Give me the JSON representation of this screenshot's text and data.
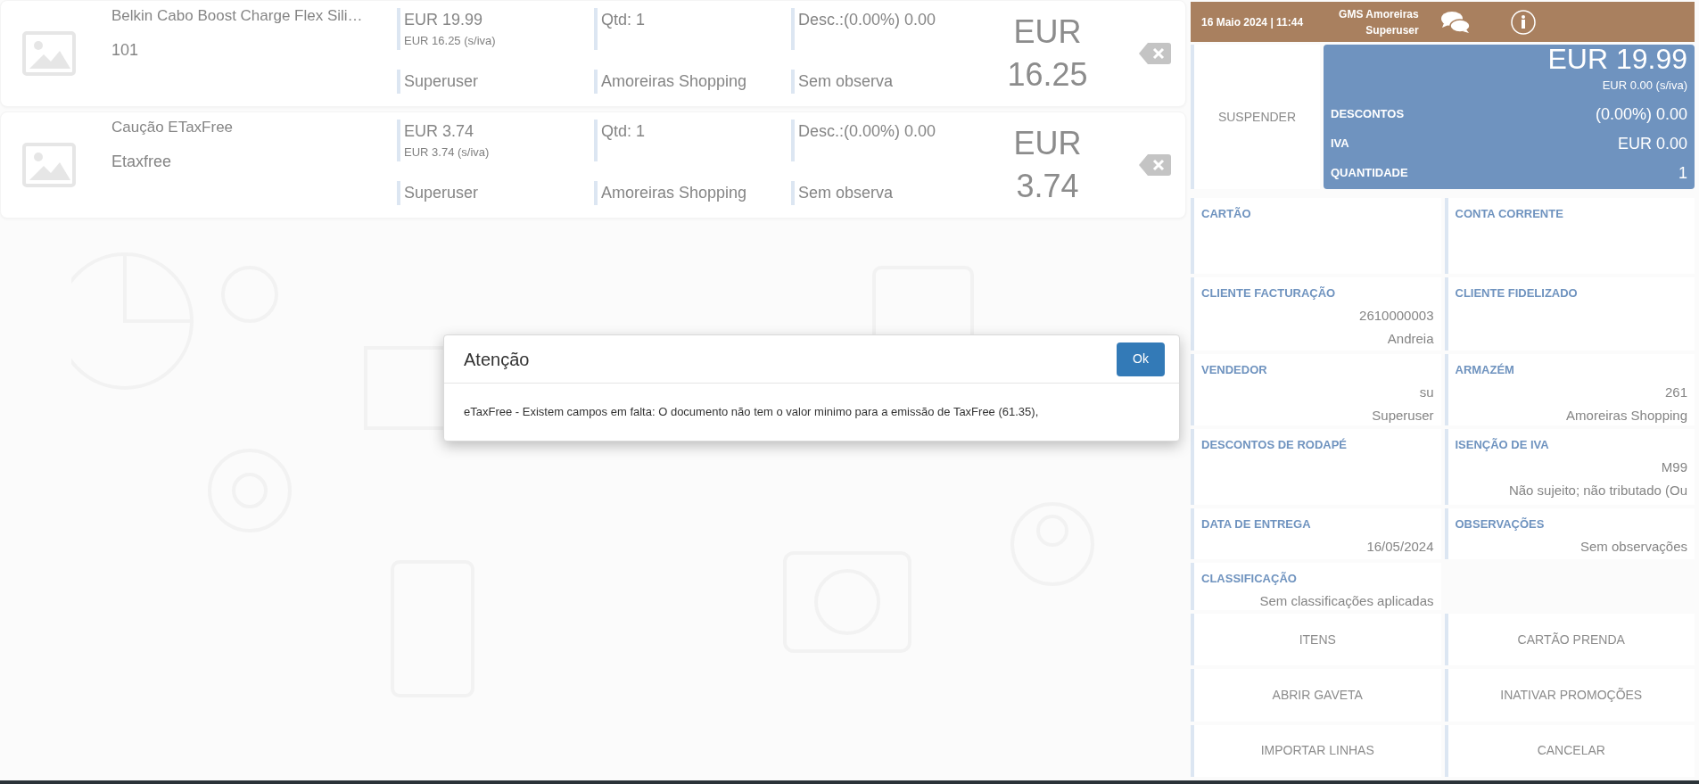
{
  "items": [
    {
      "name": "Belkin Cabo Boost Charge Flex Sili…",
      "code": "101",
      "price": "EUR 19.99",
      "price_net": "EUR 16.25 (s/iva)",
      "qty": "Qtd: 1",
      "discount": "Desc.:(0.00%) 0.00",
      "user": "Superuser",
      "store": "Amoreiras Shopping",
      "notes": "Sem observa",
      "total": "EUR 16.25"
    },
    {
      "name": "Caução ETaxFree",
      "code": "Etaxfree",
      "price": "EUR 3.74",
      "price_net": "EUR 3.74 (s/iva)",
      "qty": "Qtd: 1",
      "discount": "Desc.:(0.00%) 0.00",
      "user": "Superuser",
      "store": "Amoreiras Shopping",
      "notes": "Sem observa",
      "total": "EUR 3.74"
    }
  ],
  "header": {
    "datetime": "16 Maio 2024 | 11:44",
    "store": "GMS Amoreiras",
    "user": "Superuser"
  },
  "suspend_button": "SUSPENDER",
  "summary": {
    "total": "EUR 19.99",
    "total_net": "EUR 0.00 (s/iva)",
    "rows": [
      {
        "label": "DESCONTOS",
        "value": "(0.00%) 0.00"
      },
      {
        "label": "IVA",
        "value": "EUR 0.00"
      },
      {
        "label": "QUANTIDADE",
        "value": "1"
      }
    ]
  },
  "fields": [
    {
      "label": "CARTÃO"
    },
    {
      "label": "CONTA CORRENTE"
    },
    {
      "label": "CLIENTE FACTURAÇÃO",
      "lines": [
        "2610000003",
        "Andreia"
      ]
    },
    {
      "label": "CLIENTE FIDELIZADO"
    },
    {
      "label": "VENDEDOR",
      "lines": [
        "su",
        "Superuser"
      ]
    },
    {
      "label": "ARMAZÉM",
      "lines": [
        "261",
        "Amoreiras Shopping"
      ]
    },
    {
      "label": "DESCONTOS DE RODAPÉ"
    },
    {
      "label": "ISENÇÃO DE IVA",
      "lines": [
        "M99",
        "Não sujeito; não tributado (Ou"
      ]
    },
    {
      "label": "DATA DE ENTREGA",
      "lines": [
        "16/05/2024"
      ]
    },
    {
      "label": "OBSERVAÇÕES",
      "lines": [
        "Sem observações"
      ]
    },
    {
      "label": "CLASSIFICAÇÃO",
      "lines": [
        "Sem classificações aplicadas"
      ]
    }
  ],
  "actions": [
    "ITENS",
    "CARTÃO PRENDA",
    "ABRIR GAVETA",
    "INATIVAR PROMOÇÕES",
    "IMPORTAR LINHAS",
    "CANCELAR"
  ],
  "dialog": {
    "title": "Atenção",
    "message": "eTaxFree - Existem campos em falta: O documento não tem o valor minimo para a emissão de TaxFree (61.35),",
    "ok": "Ok"
  }
}
